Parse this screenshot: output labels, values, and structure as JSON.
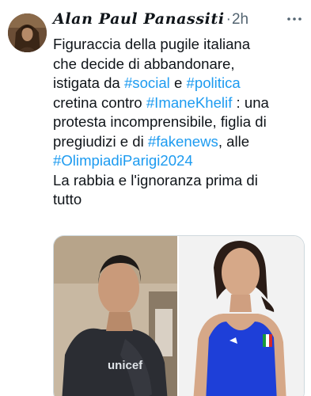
{
  "author": {
    "display_name": "Alan Paul Panassiti",
    "separator": "·",
    "time": "2h"
  },
  "icons": {
    "avatar": "profile-photo",
    "more": "more-horizontal-icon"
  },
  "tweet": {
    "lines": [
      [
        {
          "text": "Figuraccia della pugile italiana"
        }
      ],
      [
        {
          "text": "che decide di abbandonare,"
        }
      ],
      [
        {
          "text": "istigata da "
        },
        {
          "text": "#social",
          "tag": true
        },
        {
          "text": " e "
        },
        {
          "text": "#politica",
          "tag": true
        }
      ],
      [
        {
          "text": "cretina contro "
        },
        {
          "text": "#ImaneKhelif",
          "tag": true
        },
        {
          "text": " : una"
        }
      ],
      [
        {
          "text": "protesta incomprensibile, figlia di"
        }
      ],
      [
        {
          "text": "pregiudizi e di "
        },
        {
          "text": "#fakenews",
          "tag": true
        },
        {
          "text": ", alle"
        }
      ],
      [
        {
          "text": "#OlimpiadiParigi2024",
          "tag": true
        }
      ],
      [
        {
          "text": "La rabbia e l'ignoranza prima di"
        }
      ],
      [
        {
          "text": "tutto"
        }
      ]
    ]
  },
  "media": {
    "left_shirt_text": "unicef"
  },
  "colors": {
    "hashtag": "#1d9bf0",
    "text": "#0f1419",
    "muted": "#536471",
    "boxing_vest": "#1e3fd8"
  }
}
